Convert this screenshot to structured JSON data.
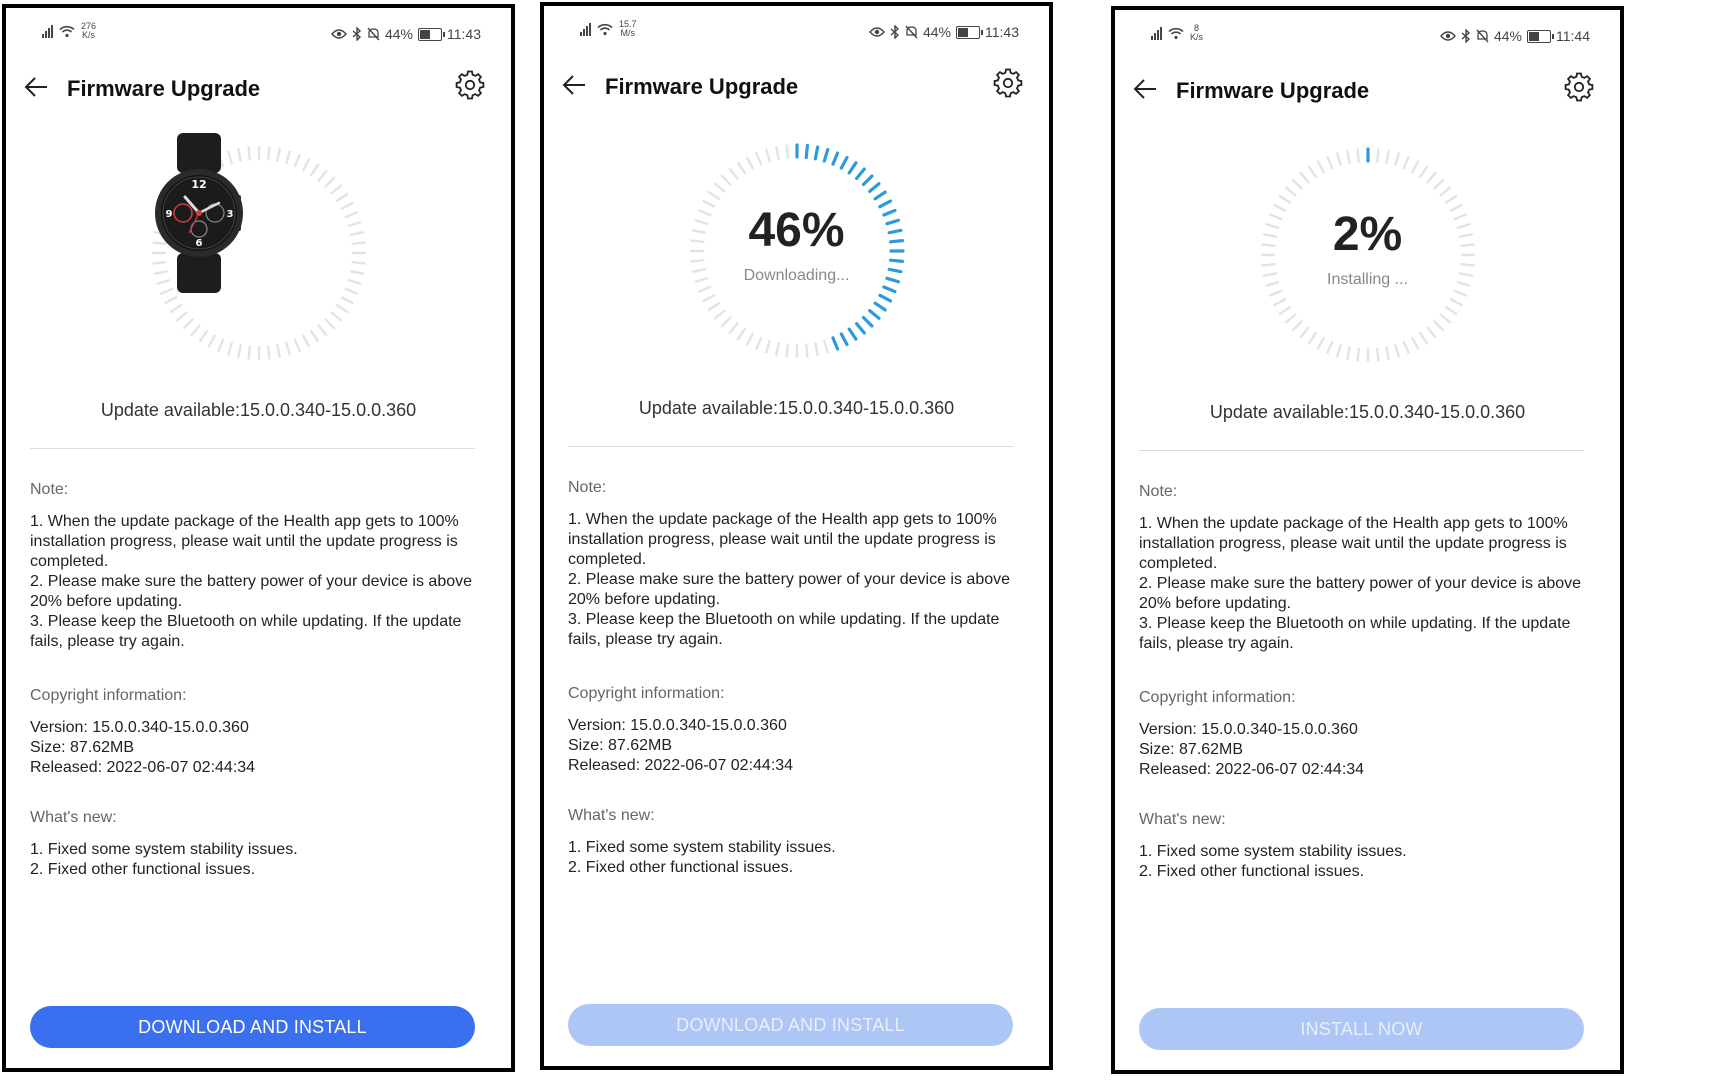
{
  "colors": {
    "primary": "#3a6ff0",
    "primary_disabled": "#aec6f5",
    "progress_blue": "#2e9ad9",
    "ring_gray": "#e3e3e3"
  },
  "icons": {
    "back": "arrow-left-icon",
    "settings": "gear-icon",
    "bluetooth": "bluetooth-icon",
    "eye": "eye-icon",
    "mute": "bell-off-icon",
    "wifi": "wifi-icon"
  },
  "screens": [
    {
      "status": {
        "speed_top": "276",
        "speed_unit": "K/s",
        "battery": "44%",
        "time": "11:43"
      },
      "title": "Firmware Upgrade",
      "ring": {
        "mode": "image",
        "progress": 0,
        "percent": "",
        "status": ""
      },
      "update_available": "Update available:15.0.0.340-15.0.0.360",
      "note_heading": "Note:",
      "notes": [
        "1. When the update package of the Health app gets to 100% installation progress, please wait until the update progress is completed.",
        "2. Please make sure the battery power of your device is above 20% before updating.",
        "3. Please keep the Bluetooth on while updating. If the update fails, please try again."
      ],
      "copyright_heading": "Copyright information:",
      "version": "Version: 15.0.0.340-15.0.0.360",
      "size": "Size: 87.62MB",
      "released": "Released: 2022-06-07 02:44:34",
      "whatsnew_heading": "What's new:",
      "whatsnew": [
        "1. Fixed some system stability issues.",
        "2. Fixed other functional issues."
      ],
      "button": {
        "label": "DOWNLOAD AND INSTALL",
        "enabled": true
      }
    },
    {
      "status": {
        "speed_top": "15.7",
        "speed_unit": "M/s",
        "battery": "44%",
        "time": "11:43"
      },
      "title": "Firmware Upgrade",
      "ring": {
        "mode": "progress",
        "progress": 0.46,
        "percent": "46%",
        "status": "Downloading..."
      },
      "update_available": "Update available:15.0.0.340-15.0.0.360",
      "note_heading": "Note:",
      "notes": [
        "1. When the update package of the Health app gets to 100% installation progress, please wait until the update progress is completed.",
        "2. Please make sure the battery power of your device is above 20% before updating.",
        "3. Please keep the Bluetooth on while updating. If the update fails, please try again."
      ],
      "copyright_heading": "Copyright information:",
      "version": "Version: 15.0.0.340-15.0.0.360",
      "size": "Size: 87.62MB",
      "released": "Released: 2022-06-07 02:44:34",
      "whatsnew_heading": "What's new:",
      "whatsnew": [
        "1. Fixed some system stability issues.",
        "2. Fixed other functional issues."
      ],
      "button": {
        "label": "DOWNLOAD AND INSTALL",
        "enabled": false
      }
    },
    {
      "status": {
        "speed_top": "8",
        "speed_unit": "K/s",
        "battery": "44%",
        "time": "11:44"
      },
      "title": "Firmware Upgrade",
      "ring": {
        "mode": "progress",
        "progress": 0.02,
        "percent": "2%",
        "status": "Installing ..."
      },
      "update_available": "Update available:15.0.0.340-15.0.0.360",
      "note_heading": "Note:",
      "notes": [
        "1. When the update package of the Health app gets to 100% installation progress, please wait until the update progress is completed.",
        "2. Please make sure the battery power of your device is above 20% before updating.",
        "3. Please keep the Bluetooth on while updating. If the update fails, please try again."
      ],
      "copyright_heading": "Copyright information:",
      "version": "Version: 15.0.0.340-15.0.0.360",
      "size": "Size: 87.62MB",
      "released": "Released: 2022-06-07 02:44:34",
      "whatsnew_heading": "What's new:",
      "whatsnew": [
        "1. Fixed some system stability issues.",
        "2. Fixed other functional issues."
      ],
      "button": {
        "label": "INSTALL NOW",
        "enabled": false
      }
    }
  ]
}
